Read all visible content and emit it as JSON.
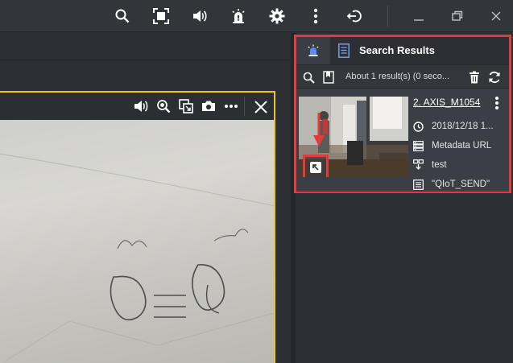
{
  "toolbar": {
    "icons": [
      "search-icon",
      "fullscreen-icon",
      "volume-icon",
      "alarm-icon",
      "gear-icon",
      "more-vertical-icon",
      "logout-icon",
      "minimize-icon",
      "restore-icon",
      "close-icon"
    ]
  },
  "video": {
    "icons": [
      "volume-icon",
      "zoom-icon",
      "snapshot-region-icon",
      "camera-icon",
      "more-horizontal-icon",
      "close-icon"
    ]
  },
  "results_panel": {
    "title": "Search Results",
    "count_text": "About 1 result(s) (0 seco...",
    "result": {
      "title": "2. AXIS_M1054",
      "timestamp": "2018/12/18 1...",
      "metadata_label": "Metadata URL",
      "event_name": "test",
      "content": "\"QIoT_SEND\""
    }
  },
  "colors": {
    "highlight": "#e23b3b",
    "video_border": "#f0c419",
    "background": "#2c3035"
  }
}
